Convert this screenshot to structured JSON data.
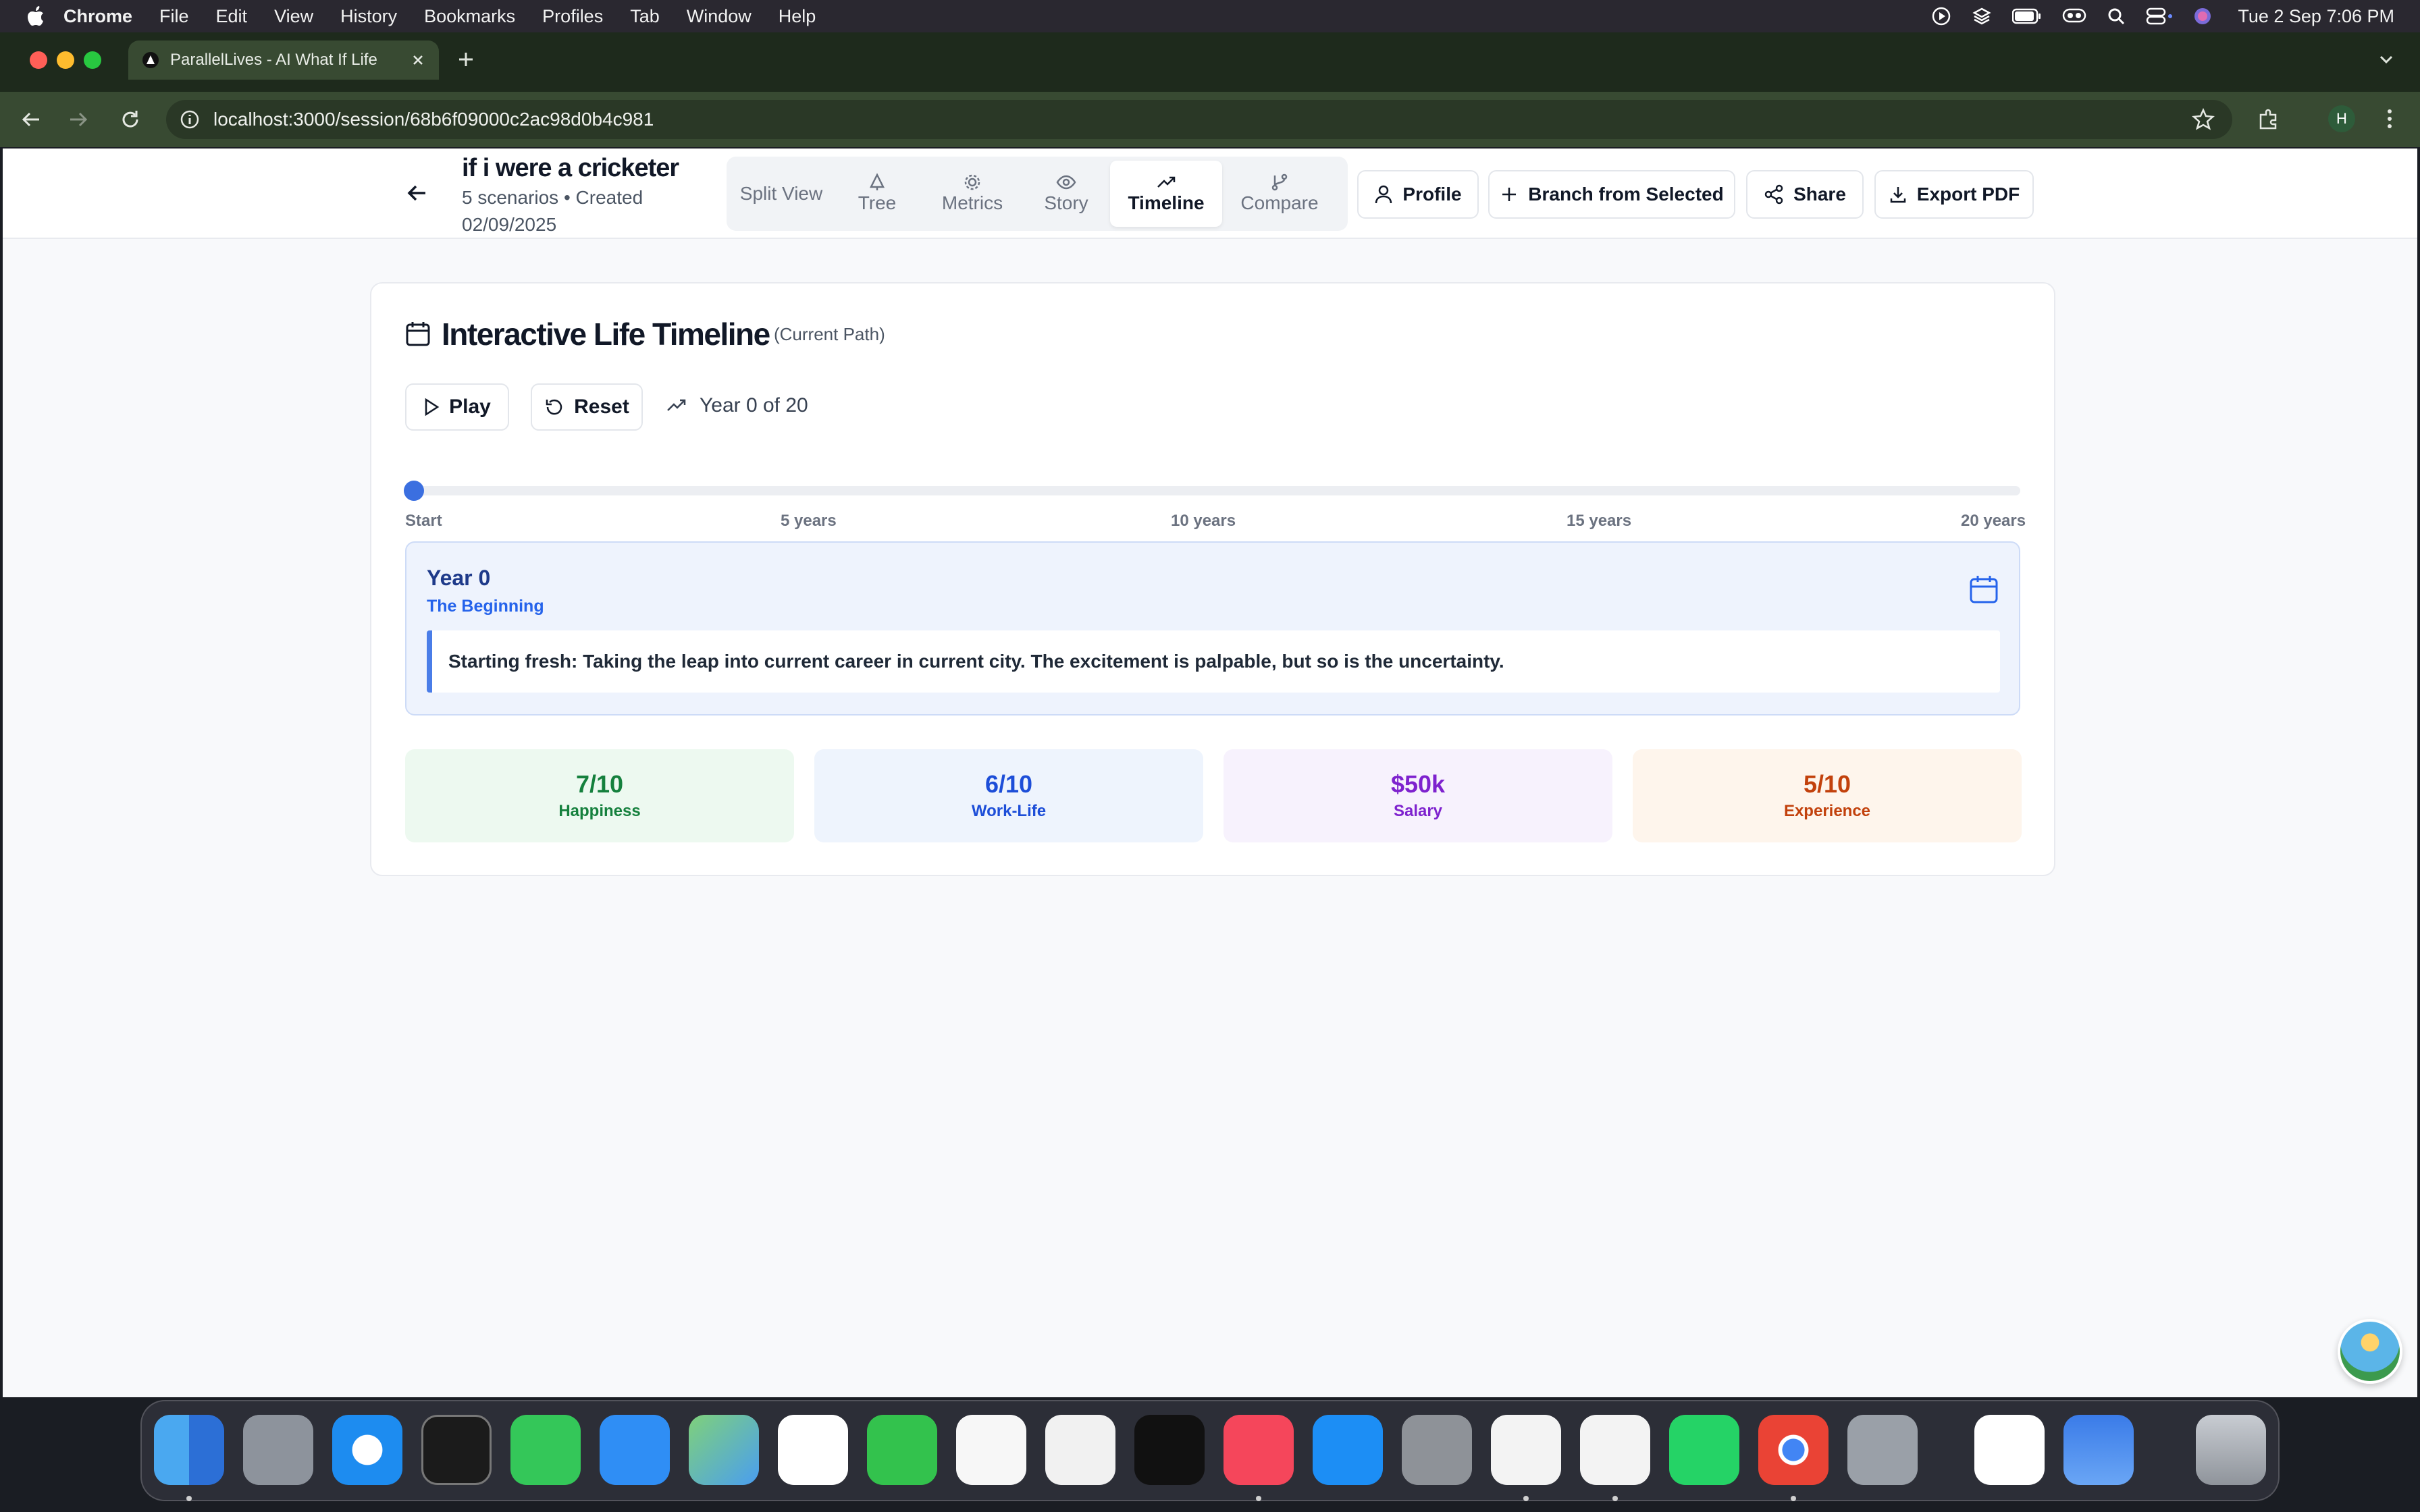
{
  "menubar": {
    "app": "Chrome",
    "items": [
      "File",
      "Edit",
      "View",
      "History",
      "Bookmarks",
      "Profiles",
      "Tab",
      "Window",
      "Help"
    ],
    "clock": "Tue 2 Sep  7:06 PM"
  },
  "browser": {
    "tab_title": "ParallelLives - AI What If Life",
    "url": "localhost:3000/session/68b6f09000c2ac98d0b4c981",
    "profile_initial": "H"
  },
  "header": {
    "session_title": "if i were a cricketer",
    "session_meta": "5 scenarios • Created 02/09/2025",
    "view_tabs": [
      {
        "label": "Split View",
        "icon": "split-icon"
      },
      {
        "label": "Tree",
        "icon": "tree-icon"
      },
      {
        "label": "Metrics",
        "icon": "gear-icon"
      },
      {
        "label": "Story",
        "icon": "eye-icon"
      },
      {
        "label": "Timeline",
        "icon": "trending-up-icon",
        "active": true
      },
      {
        "label": "Compare",
        "icon": "branch-icon"
      }
    ],
    "actions": {
      "profile": "Profile",
      "branch": "Branch from Selected",
      "share": "Share",
      "export": "Export PDF"
    }
  },
  "timeline": {
    "title": "Interactive Life Timeline",
    "subtitle": "(Current Path)",
    "play": "Play",
    "reset": "Reset",
    "year_indicator": "Year 0 of 20",
    "progress": 0,
    "ticks": [
      "Start",
      "5 years",
      "10 years",
      "15 years",
      "20 years"
    ],
    "year_card": {
      "title": "Year 0",
      "subtitle": "The Beginning",
      "text": "Starting fresh: Taking the leap into current career in current city. The excitement is palpable, but so is the uncertainty."
    },
    "metrics": [
      {
        "value": "7/10",
        "label": "Happiness",
        "bg": "#edf9f0",
        "color": "#15803d"
      },
      {
        "value": "6/10",
        "label": "Work-Life",
        "bg": "#eef4fd",
        "color": "#1d4ed8"
      },
      {
        "value": "$50k",
        "label": "Salary",
        "bg": "#f7f2fd",
        "color": "#7e22ce"
      },
      {
        "value": "5/10",
        "label": "Experience",
        "bg": "#fef5ec",
        "color": "#c2410c"
      }
    ]
  },
  "colors": {
    "accent": "#3b6fe0"
  }
}
